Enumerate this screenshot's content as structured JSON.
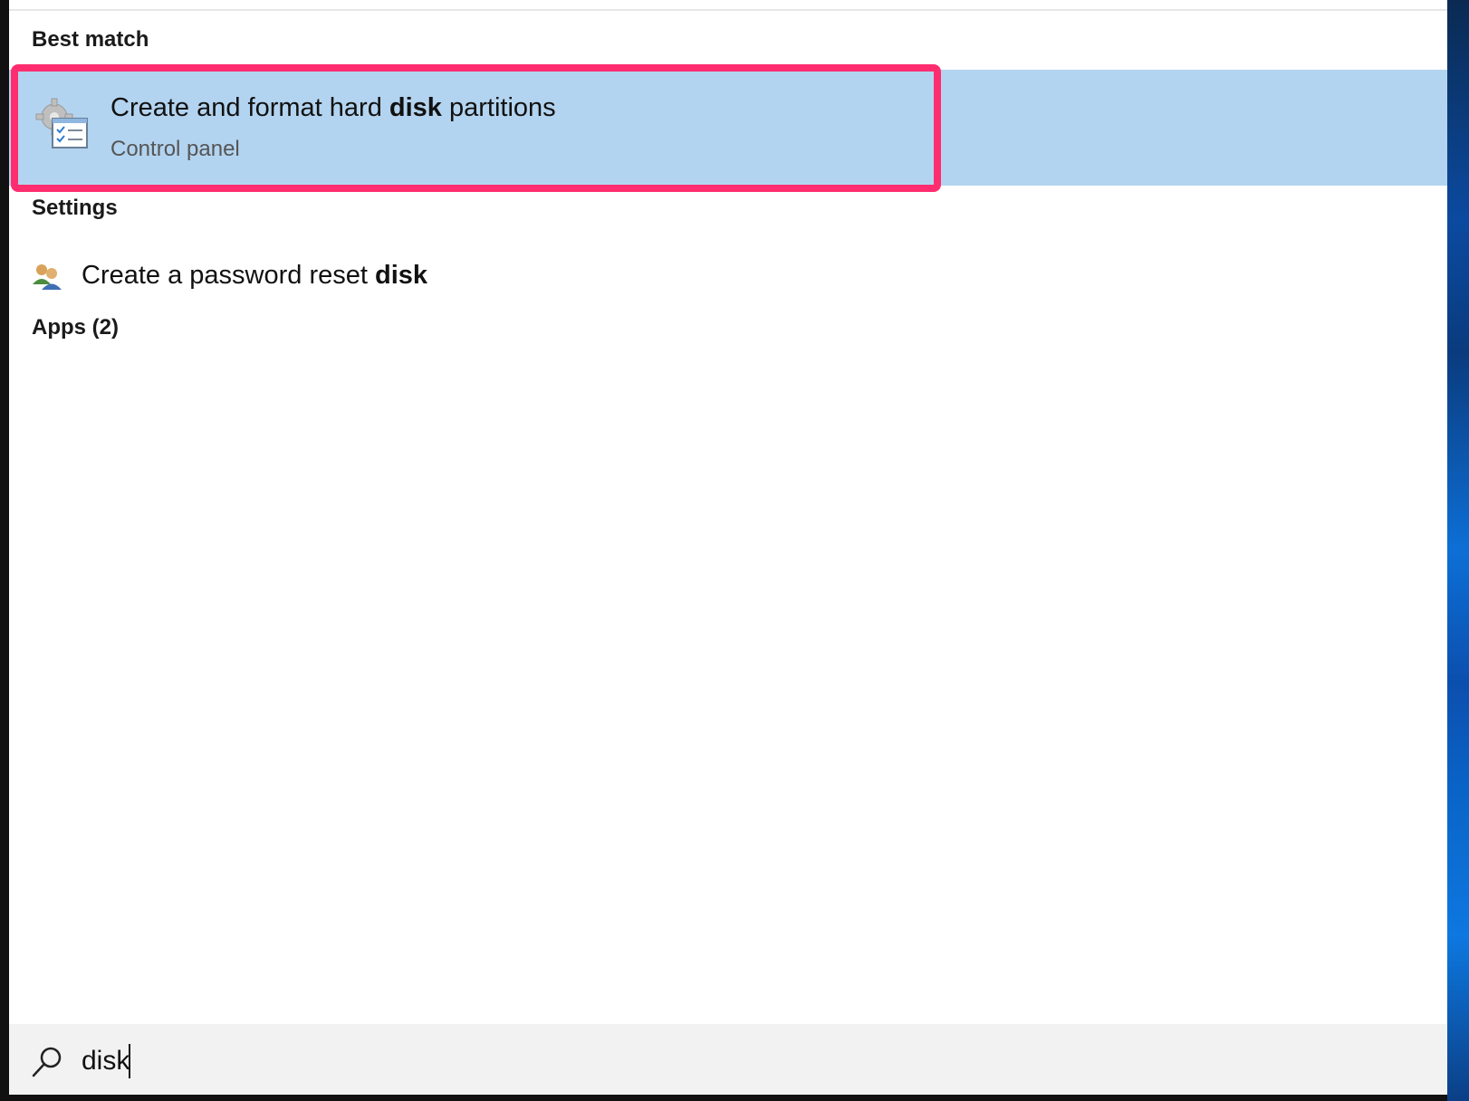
{
  "search_results": {
    "sections": {
      "best_match": "Best match",
      "settings": "Settings",
      "apps": "Apps (2)"
    },
    "best_match_item": {
      "title_pre": "Create and format hard ",
      "title_bold": "disk",
      "title_post": " partitions",
      "subtitle": "Control panel",
      "icon": "control-panel-icon"
    },
    "settings_item": {
      "text_pre": "Create a password reset ",
      "text_bold": "disk",
      "icon": "user-accounts-icon"
    }
  },
  "search": {
    "value": "disk",
    "icon": "search-icon"
  },
  "colors": {
    "selection": "#b3d4f0",
    "highlight_border": "#ff2d6f",
    "search_bar_bg": "#f2f2f2"
  }
}
